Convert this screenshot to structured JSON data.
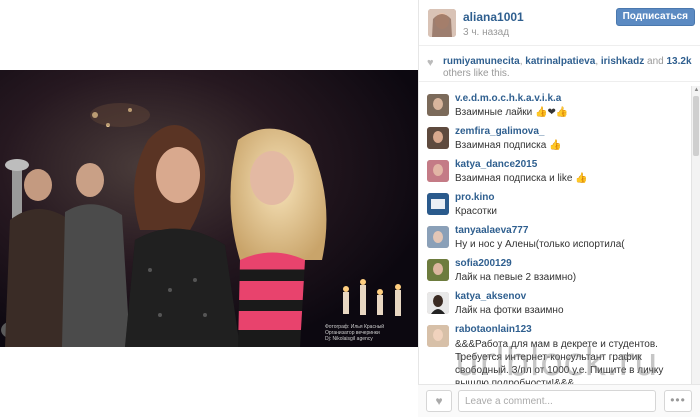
{
  "post": {
    "username": "aliana1001",
    "time_ago": "3 ч. назад",
    "follow_label": "Подписаться"
  },
  "likes": {
    "names": [
      "rumiyamunecita",
      "katrinalpatieva",
      "irishkadz"
    ],
    "separator": ",",
    "and_label": "and",
    "count": "13.2k",
    "others_text": "others like this."
  },
  "photo": {
    "credit_line1": "Фотограф: Илья Красный",
    "credit_line2": "Организатор вечеринки",
    "credit_line3": "Dj: NikolaisgiI agency"
  },
  "comments": [
    {
      "user": "v.e.d.m.o.c.h.k.a.v.i.k.a",
      "text": "Взаимные лайки 👍❤👍"
    },
    {
      "user": "zemfira_galimova_",
      "text": "Взаимная подписка 👍"
    },
    {
      "user": "katya_dance2015",
      "text": "Взаимная подписка и like 👍"
    },
    {
      "user": "pro.kino",
      "text": "Красотки"
    },
    {
      "user": "tanyaalaeva777",
      "text": "Ну и нос у Алены(только испортила("
    },
    {
      "user": "sofia200129",
      "text": "Лайк на певые 2 взаимно)"
    },
    {
      "user": "katya_aksenov",
      "text": "Лайк на фотки взаимно"
    },
    {
      "user": "rabotaonlain123",
      "text": "&&&Работа для мам в декрете и студентов. Требуется интернет-консультант график свободный. З/пл от 1000 у.е. Пишите в личку вышлю подробности!&&&"
    }
  ],
  "watermark": "urlblock.ru",
  "comment_input": {
    "placeholder": "Leave a comment..."
  },
  "icons": {
    "heart": "heart-icon",
    "more": "ellipsis-icon"
  },
  "colors": {
    "link": "#2f5f8f",
    "follow_button": "#5b8ac2"
  }
}
